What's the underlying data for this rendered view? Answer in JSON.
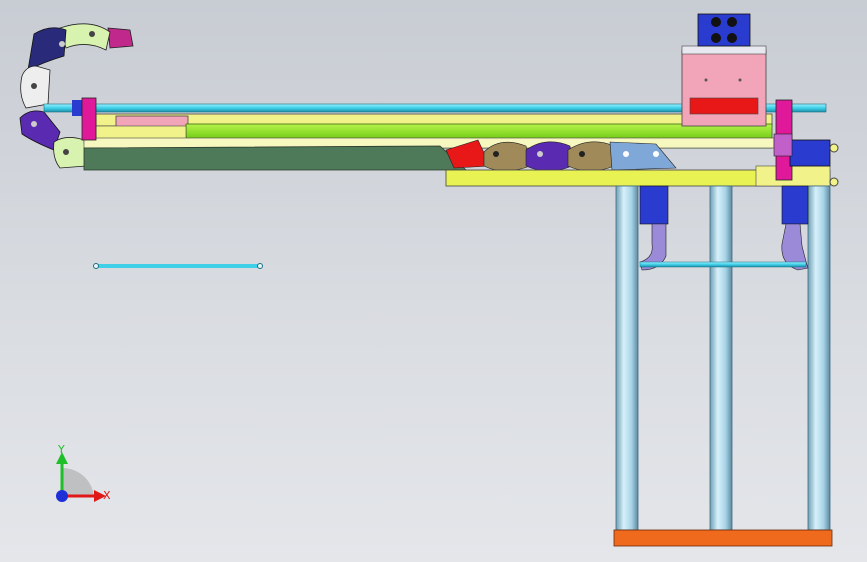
{
  "viewport": {
    "background_top": "#c8ccd3",
    "background_bottom": "#e4e6ea"
  },
  "triad": {
    "x_label": "X",
    "y_label": "Y",
    "x_color": "#e01818",
    "y_color": "#1fbf2a",
    "z_color": "#1f2fd8"
  },
  "colors": {
    "beam_yellow": "#f2f28a",
    "rail_green": "#7fd420",
    "cover_dark_green": "#4f7a5a",
    "column_blue": "#a9d4e8",
    "base_orange": "#f06a1e",
    "head_pink": "#f2a5b8",
    "head_block_blue": "#2a3bd0",
    "chain_purple": "#5a2ab0",
    "chain_navy": "#2a2a7a",
    "chain_magenta": "#c0288c",
    "chain_light": "#d8f2b0",
    "chain_white": "#eeeeee",
    "shaft_cyan": "#3fd0e8",
    "bracket_purple": "#9a8ad8"
  }
}
